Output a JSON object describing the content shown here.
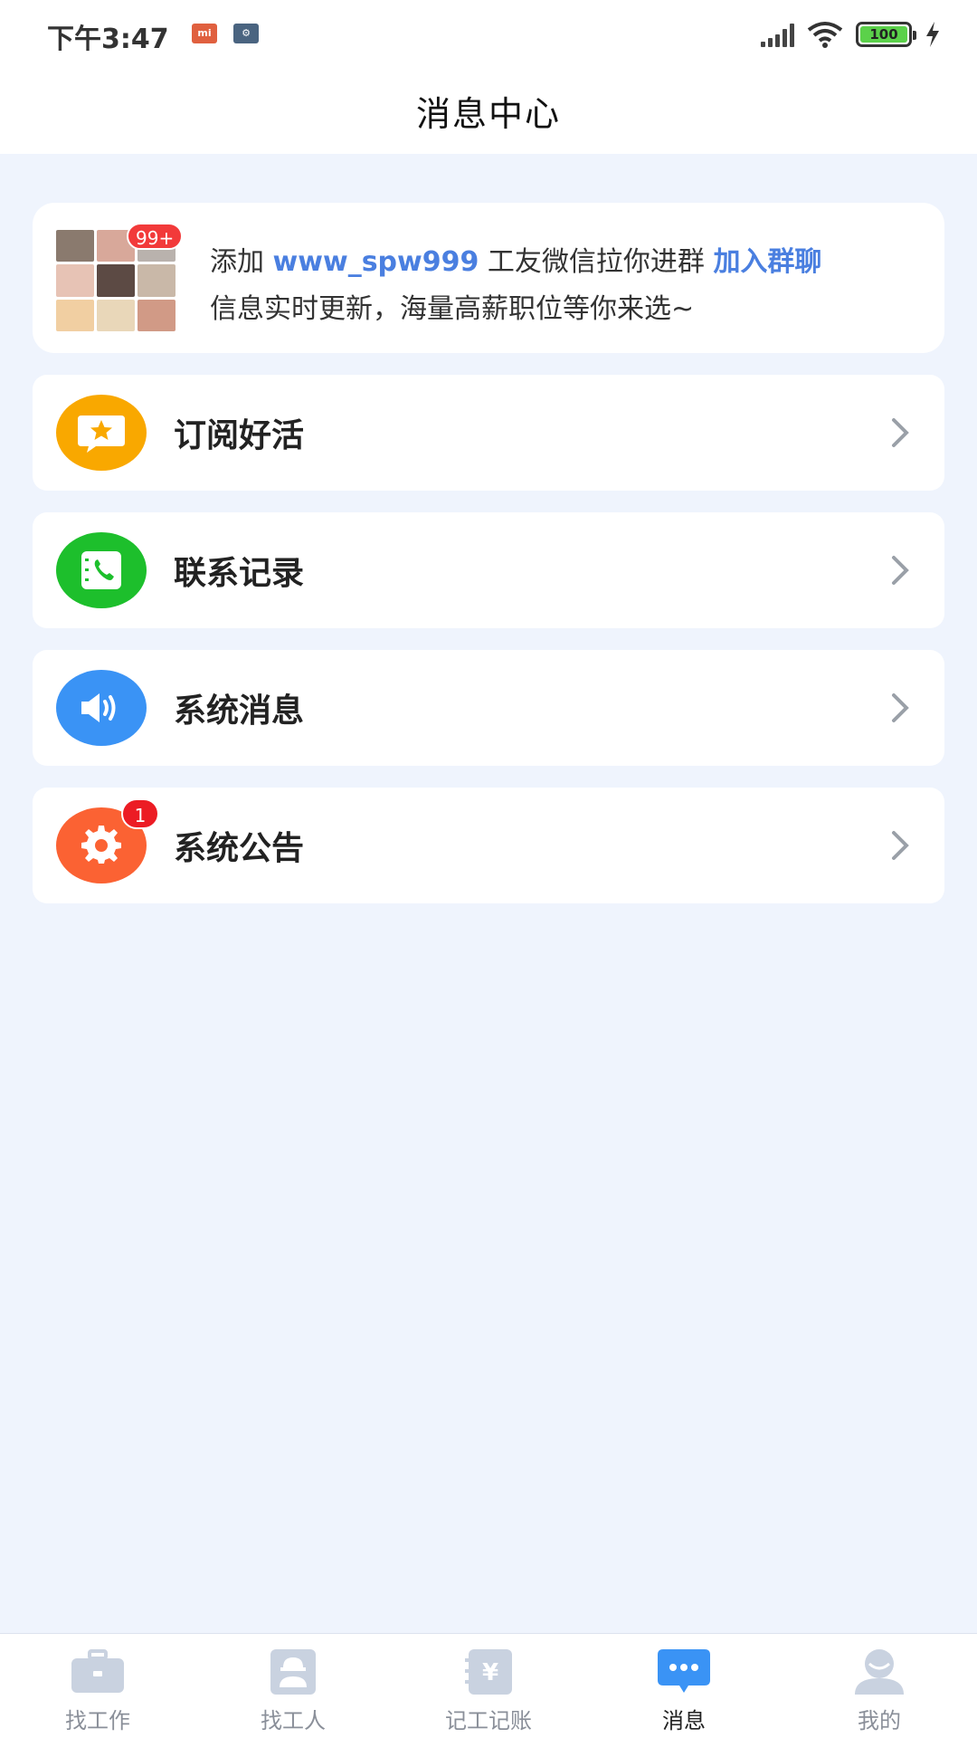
{
  "status_bar": {
    "time": "下午3:47",
    "battery": "100",
    "icons": [
      "mi-app-icon",
      "settings-app-icon",
      "signal-icon",
      "wifi-icon",
      "battery-icon",
      "charging-icon"
    ]
  },
  "header": {
    "title": "消息中心"
  },
  "banner": {
    "badge": "99+",
    "prefix": "添加 ",
    "wechat_id": "www_spw999",
    "middle": " 工友微信拉你进群 ",
    "join_link": "加入群聊",
    "subtitle": "信息实时更新，海量高薪职位等你来选~"
  },
  "menu": [
    {
      "label": "订阅好活",
      "icon": "star-bubble-icon",
      "color": "#f9a800"
    },
    {
      "label": "联系记录",
      "icon": "phone-book-icon",
      "color": "#1dbf2c"
    },
    {
      "label": "系统消息",
      "icon": "speaker-icon",
      "color": "#3a93f5"
    },
    {
      "label": "系统公告",
      "icon": "gear-icon",
      "color": "#fb6233",
      "badge": "1"
    }
  ],
  "bottom_nav": [
    {
      "label": "找工作",
      "icon": "briefcase-icon",
      "active": false
    },
    {
      "label": "找工人",
      "icon": "worker-icon",
      "active": false
    },
    {
      "label": "记工记账",
      "icon": "ledger-icon",
      "active": false
    },
    {
      "label": "消息",
      "icon": "chat-icon",
      "active": true
    },
    {
      "label": "我的",
      "icon": "profile-icon",
      "active": false
    }
  ],
  "colors": {
    "accent": "#4a7fe0",
    "background": "#eff4fd",
    "badge_red": "#ec1c24",
    "nav_active": "#3a93f5",
    "nav_inactive": "#c9d2e0"
  }
}
